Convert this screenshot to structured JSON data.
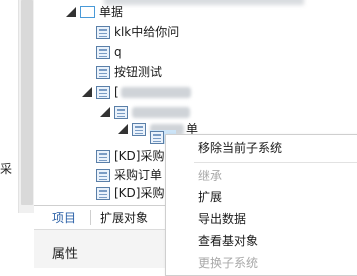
{
  "left_panel": {
    "truncated_text": "采"
  },
  "tree": {
    "items": [
      {
        "label": "单据"
      },
      {
        "label": "klk中给你问"
      },
      {
        "label": "q"
      },
      {
        "label": "按钮测试"
      },
      {
        "label": "["
      },
      {
        "label": ""
      },
      {
        "label": "单"
      },
      {
        "label": ""
      },
      {
        "label": "[KD]采购"
      },
      {
        "label": "采购订单"
      },
      {
        "label": "[KD]采购"
      }
    ]
  },
  "tabs": {
    "project": "项目",
    "extend_objects": "扩展对象"
  },
  "properties": {
    "title": "属性"
  },
  "context_menu": {
    "items": [
      {
        "label": "移除当前子系统",
        "enabled": true
      },
      {
        "label": "继承",
        "enabled": false
      },
      {
        "label": "扩展",
        "enabled": true
      },
      {
        "label": "导出数据",
        "enabled": true
      },
      {
        "label": "查看基对象",
        "enabled": true
      },
      {
        "label": "更换子系统",
        "enabled": false
      }
    ]
  },
  "colors": {
    "selection": "#cce4f7",
    "tab_active": "#2e63a8",
    "disabled": "#a8a8a8"
  }
}
